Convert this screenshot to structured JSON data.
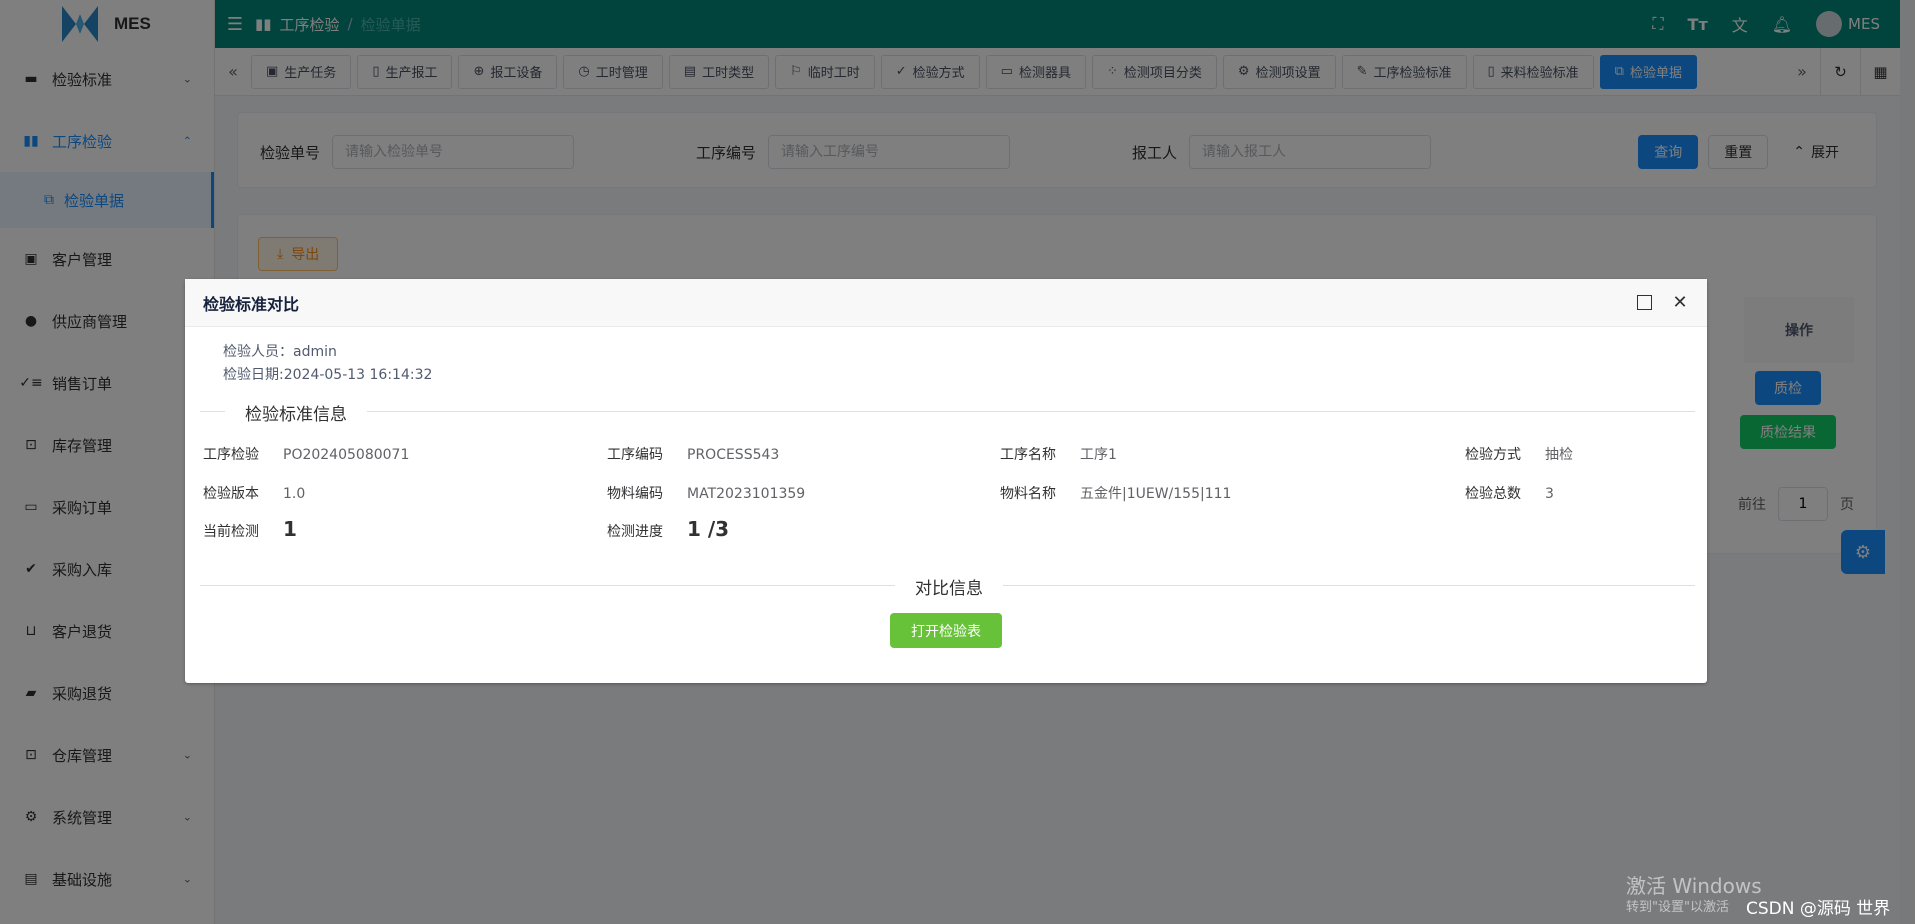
{
  "app": {
    "logo_text": "MES"
  },
  "sidebar": {
    "items": [
      {
        "label": "检验标准",
        "icon": "monitor-icon",
        "chevron": "down"
      },
      {
        "label": "工序检验",
        "icon": "book-icon",
        "chevron": "up",
        "active": true
      },
      {
        "label": "客户管理",
        "icon": "contact-icon"
      },
      {
        "label": "供应商管理",
        "icon": "user-icon"
      },
      {
        "label": "销售订单",
        "icon": "checklist-icon"
      },
      {
        "label": "库存管理",
        "icon": "box-icon"
      },
      {
        "label": "采购订单",
        "icon": "briefcase-icon"
      },
      {
        "label": "采购入库",
        "icon": "double-check-icon"
      },
      {
        "label": "客户退货",
        "icon": "inbox-icon"
      },
      {
        "label": "采购退货",
        "icon": "ticket-icon"
      },
      {
        "label": "仓库管理",
        "icon": "warehouse-icon",
        "chevron": "down"
      },
      {
        "label": "系统管理",
        "icon": "gear-icon",
        "chevron": "down"
      },
      {
        "label": "基础设施",
        "icon": "document-icon",
        "chevron": "down"
      }
    ],
    "sub_item": {
      "label": "检验单据",
      "icon": "copy-icon"
    }
  },
  "header": {
    "breadcrumb": [
      "工序检验",
      "检验单据"
    ],
    "user": "MES"
  },
  "tags": {
    "items": [
      "生产任务",
      "生产报工",
      "报工设备",
      "工时管理",
      "工时类型",
      "临时工时",
      "检验方式",
      "检测器具",
      "检测项目分类",
      "检测项设置",
      "工序检验标准",
      "来料检验标准",
      "检验单据"
    ],
    "active": "检验单据"
  },
  "search": {
    "field1_label": "检验单号",
    "field1_placeholder": "请输入检验单号",
    "field2_label": "工序编号",
    "field2_placeholder": "请输入工序编号",
    "field3_label": "报工人",
    "field3_placeholder": "请输入报工人",
    "query_label": "查询",
    "reset_label": "重置",
    "expand_label": "展开"
  },
  "table": {
    "export_label": "导出",
    "op_header": "操作",
    "qc_button": "质检",
    "qc_result_button": "质检结果",
    "pager_goto": "前往",
    "pager_page": "1",
    "pager_unit": "页"
  },
  "dialog": {
    "title": "检验标准对比",
    "inspector": "检验人员：admin",
    "date": "检验日期:2024-05-13 16:14:32",
    "section1": "检验标准信息",
    "section2": "对比信息",
    "fields": {
      "process_inspect_k": "工序检验",
      "process_inspect_v": "PO202405080071",
      "process_code_k": "工序编码",
      "process_code_v": "PROCESS543",
      "process_name_k": "工序名称",
      "process_name_v": "工序1",
      "method_k": "检验方式",
      "method_v": "抽检",
      "version_k": "检验版本",
      "version_v": "1.0",
      "material_code_k": "物料编码",
      "material_code_v": "MAT2023101359",
      "material_name_k": "物料名称",
      "material_name_v": "五金件|1UEW/155|111",
      "total_k": "检验总数",
      "total_v": "3",
      "current_k": "当前检测",
      "current_v": "1",
      "progress_k": "检测进度",
      "progress_v": "1 /3"
    },
    "open_button": "打开检验表"
  },
  "watermark": {
    "line1": "激活 Windows",
    "line2": "转到\"设置\"以激活",
    "csdn": "CSDN @源码 世界"
  }
}
